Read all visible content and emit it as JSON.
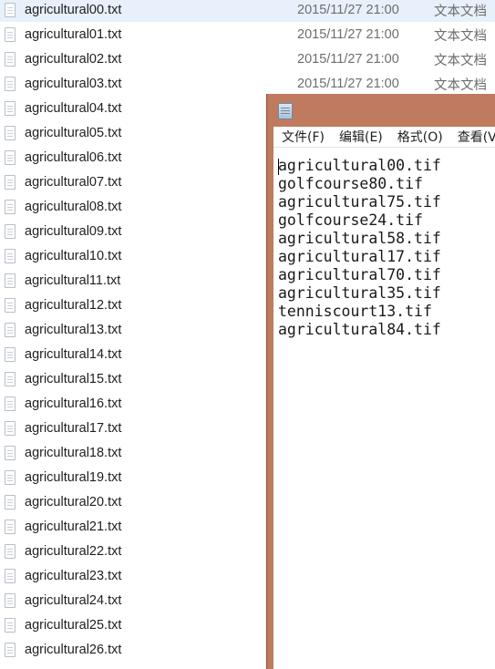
{
  "explorer": {
    "files": [
      {
        "name": "agricultural00.txt",
        "date": "2015/11/27 21:00",
        "type": "文本文档"
      },
      {
        "name": "agricultural01.txt",
        "date": "2015/11/27 21:00",
        "type": "文本文档"
      },
      {
        "name": "agricultural02.txt",
        "date": "2015/11/27 21:00",
        "type": "文本文档"
      },
      {
        "name": "agricultural03.txt",
        "date": "2015/11/27 21:00",
        "type": "文本文档"
      },
      {
        "name": "agricultural04.txt",
        "date": "",
        "type": ""
      },
      {
        "name": "agricultural05.txt",
        "date": "",
        "type": ""
      },
      {
        "name": "agricultural06.txt",
        "date": "",
        "type": ""
      },
      {
        "name": "agricultural07.txt",
        "date": "",
        "type": ""
      },
      {
        "name": "agricultural08.txt",
        "date": "",
        "type": ""
      },
      {
        "name": "agricultural09.txt",
        "date": "",
        "type": ""
      },
      {
        "name": "agricultural10.txt",
        "date": "",
        "type": ""
      },
      {
        "name": "agricultural11.txt",
        "date": "",
        "type": ""
      },
      {
        "name": "agricultural12.txt",
        "date": "",
        "type": ""
      },
      {
        "name": "agricultural13.txt",
        "date": "",
        "type": ""
      },
      {
        "name": "agricultural14.txt",
        "date": "",
        "type": ""
      },
      {
        "name": "agricultural15.txt",
        "date": "",
        "type": ""
      },
      {
        "name": "agricultural16.txt",
        "date": "",
        "type": ""
      },
      {
        "name": "agricultural17.txt",
        "date": "",
        "type": ""
      },
      {
        "name": "agricultural18.txt",
        "date": "",
        "type": ""
      },
      {
        "name": "agricultural19.txt",
        "date": "",
        "type": ""
      },
      {
        "name": "agricultural20.txt",
        "date": "",
        "type": ""
      },
      {
        "name": "agricultural21.txt",
        "date": "",
        "type": ""
      },
      {
        "name": "agricultural22.txt",
        "date": "",
        "type": ""
      },
      {
        "name": "agricultural23.txt",
        "date": "",
        "type": ""
      },
      {
        "name": "agricultural24.txt",
        "date": "",
        "type": ""
      },
      {
        "name": "agricultural25.txt",
        "date": "",
        "type": ""
      },
      {
        "name": "agricultural26.txt",
        "date": "",
        "type": ""
      }
    ],
    "selected_row_color": "#e8f0fb",
    "file_icon": "text-file-icon"
  },
  "notepad": {
    "app_icon": "notepad-icon",
    "menus": [
      "文件(F)",
      "编辑(E)",
      "格式(O)",
      "查看(V"
    ],
    "content_lines": [
      "agricultural00.tif",
      "golfcourse80.tif",
      "agricultural75.tif",
      "golfcourse24.tif",
      "agricultural58.tif",
      "agricultural17.tif",
      "agricultural70.tif",
      "agricultural35.tif",
      "tenniscourt13.tif",
      "agricultural84.tif"
    ],
    "frame_color": "#c07a5f"
  }
}
